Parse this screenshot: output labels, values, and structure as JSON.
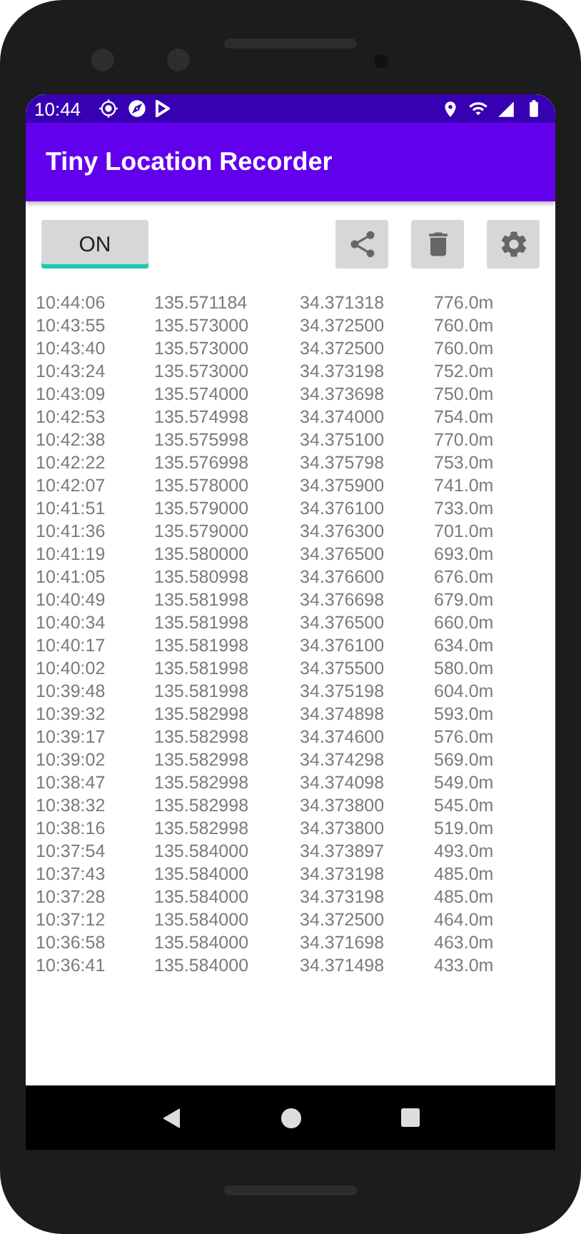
{
  "status_bar": {
    "time": "10:44"
  },
  "app_bar": {
    "title": "Tiny Location Recorder"
  },
  "toggle": {
    "label": "ON",
    "on": true
  },
  "records": [
    [
      "10:44:06",
      "135.571184",
      "34.371318",
      "776.0m"
    ],
    [
      "10:43:55",
      "135.573000",
      "34.372500",
      "760.0m"
    ],
    [
      "10:43:40",
      "135.573000",
      "34.372500",
      "760.0m"
    ],
    [
      "10:43:24",
      "135.573000",
      "34.373198",
      "752.0m"
    ],
    [
      "10:43:09",
      "135.574000",
      "34.373698",
      "750.0m"
    ],
    [
      "10:42:53",
      "135.574998",
      "34.374000",
      "754.0m"
    ],
    [
      "10:42:38",
      "135.575998",
      "34.375100",
      "770.0m"
    ],
    [
      "10:42:22",
      "135.576998",
      "34.375798",
      "753.0m"
    ],
    [
      "10:42:07",
      "135.578000",
      "34.375900",
      "741.0m"
    ],
    [
      "10:41:51",
      "135.579000",
      "34.376100",
      "733.0m"
    ],
    [
      "10:41:36",
      "135.579000",
      "34.376300",
      "701.0m"
    ],
    [
      "10:41:19",
      "135.580000",
      "34.376500",
      "693.0m"
    ],
    [
      "10:41:05",
      "135.580998",
      "34.376600",
      "676.0m"
    ],
    [
      "10:40:49",
      "135.581998",
      "34.376698",
      "679.0m"
    ],
    [
      "10:40:34",
      "135.581998",
      "34.376500",
      "660.0m"
    ],
    [
      "10:40:17",
      "135.581998",
      "34.376100",
      "634.0m"
    ],
    [
      "10:40:02",
      "135.581998",
      "34.375500",
      "580.0m"
    ],
    [
      "10:39:48",
      "135.581998",
      "34.375198",
      "604.0m"
    ],
    [
      "10:39:32",
      "135.582998",
      "34.374898",
      "593.0m"
    ],
    [
      "10:39:17",
      "135.582998",
      "34.374600",
      "576.0m"
    ],
    [
      "10:39:02",
      "135.582998",
      "34.374298",
      "569.0m"
    ],
    [
      "10:38:47",
      "135.582998",
      "34.374098",
      "549.0m"
    ],
    [
      "10:38:32",
      "135.582998",
      "34.373800",
      "545.0m"
    ],
    [
      "10:38:16",
      "135.582998",
      "34.373800",
      "519.0m"
    ],
    [
      "10:37:54",
      "135.584000",
      "34.373897",
      "493.0m"
    ],
    [
      "10:37:43",
      "135.584000",
      "34.373198",
      "485.0m"
    ],
    [
      "10:37:28",
      "135.584000",
      "34.373198",
      "485.0m"
    ],
    [
      "10:37:12",
      "135.584000",
      "34.372500",
      "464.0m"
    ],
    [
      "10:36:58",
      "135.584000",
      "34.371698",
      "463.0m"
    ],
    [
      "10:36:41",
      "135.584000",
      "34.371498",
      "433.0m"
    ]
  ]
}
